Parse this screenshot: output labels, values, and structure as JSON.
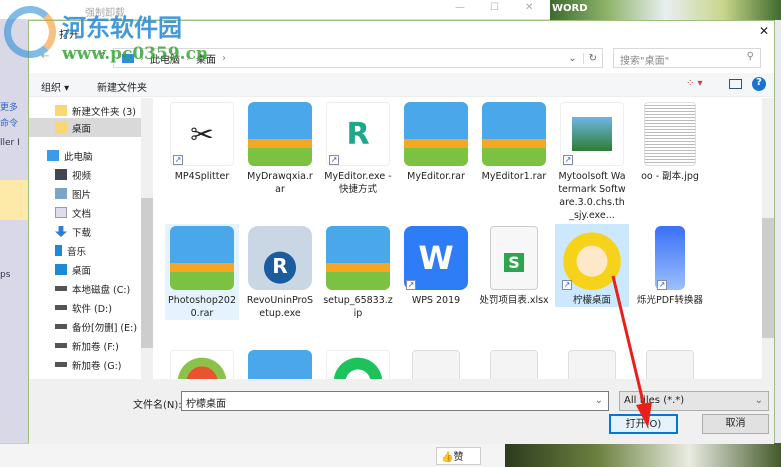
{
  "background": {
    "window_title": "强制卸载",
    "word_label": "WORD",
    "left_labels": [
      "更多",
      "命令",
      "ller I",
      "ps"
    ],
    "like_label": "赞",
    "window_controls": {
      "minimize": "—",
      "maximize": "☐",
      "close": "✕"
    }
  },
  "watermark": {
    "brand": "河东软件园",
    "url": "www.pc0359.cn"
  },
  "dialog": {
    "title": "打开",
    "close": "✕",
    "breadcrumb": [
      "此电脑",
      "桌面"
    ],
    "search_placeholder": "搜索\"桌面\"",
    "toolbar": {
      "organize": "组织 ▾",
      "new_folder": "新建文件夹"
    },
    "nav": [
      {
        "label": "新建文件夹 (3)",
        "icon": "folder-icon"
      },
      {
        "label": "桌面",
        "icon": "folder-icon",
        "selected": true
      },
      {
        "label": "此电脑",
        "icon": "computer-icon"
      },
      {
        "label": "视频",
        "icon": "video-icon"
      },
      {
        "label": "图片",
        "icon": "picture-icon"
      },
      {
        "label": "文档",
        "icon": "document-icon"
      },
      {
        "label": "下载",
        "icon": "download-icon"
      },
      {
        "label": "音乐",
        "icon": "music-icon"
      },
      {
        "label": "桌面",
        "icon": "desktop-icon"
      },
      {
        "label": "本地磁盘 (C:)",
        "icon": "drive-icon"
      },
      {
        "label": "软件 (D:)",
        "icon": "drive-icon"
      },
      {
        "label": "备份[勿删] (E:)",
        "icon": "drive-icon"
      },
      {
        "label": "新加卷 (F:)",
        "icon": "drive-icon"
      },
      {
        "label": "新加卷 (G:)",
        "icon": "drive-icon"
      }
    ],
    "files": [
      {
        "name": "MP4Splitter",
        "type": "app",
        "shortcut": true
      },
      {
        "name": "MyDrawqxia.rar",
        "type": "zip"
      },
      {
        "name": "MyEditor.exe - 快捷方式",
        "type": "editor",
        "shortcut": true
      },
      {
        "name": "MyEditor.rar",
        "type": "zip"
      },
      {
        "name": "MyEditor1.rar",
        "type": "zip"
      },
      {
        "name": "Mytoolsoft Watermark Software.3.0.chs.th_sjy.exe...",
        "type": "image-app",
        "shortcut": true
      },
      {
        "name": "oo - 副本.jpg",
        "type": "jpg"
      },
      {
        "name": "Photoshop2020.rar",
        "type": "zip",
        "hover": true
      },
      {
        "name": "RevoUninProSetup.exe",
        "type": "revo"
      },
      {
        "name": "setup_65833.zip",
        "type": "zip"
      },
      {
        "name": "WPS 2019",
        "type": "wps",
        "shortcut": true
      },
      {
        "name": "处罚项目表.xlsx",
        "type": "xlsx"
      },
      {
        "name": "柠檬桌面",
        "type": "lemon",
        "shortcut": true,
        "selected": true
      },
      {
        "name": "烁光PDF转换器",
        "type": "pdf",
        "shortcut": true
      },
      {
        "name": "",
        "type": "red-app",
        "shortcut": true
      },
      {
        "name": "",
        "type": "zip"
      },
      {
        "name": "",
        "type": "green-app",
        "shortcut": true
      },
      {
        "name": "",
        "type": "blank"
      },
      {
        "name": "",
        "type": "blank"
      },
      {
        "name": "",
        "type": "blank"
      },
      {
        "name": "",
        "type": "blank"
      }
    ],
    "filename_label": "文件名(N):",
    "filename_value": "柠檬桌面",
    "filter": "All files (*.*)",
    "open_button": "打开(O)",
    "cancel_button": "取消"
  },
  "colors": {
    "accent": "#0078d7",
    "selection": "#cce8ff",
    "arrow": "#e8201a"
  }
}
